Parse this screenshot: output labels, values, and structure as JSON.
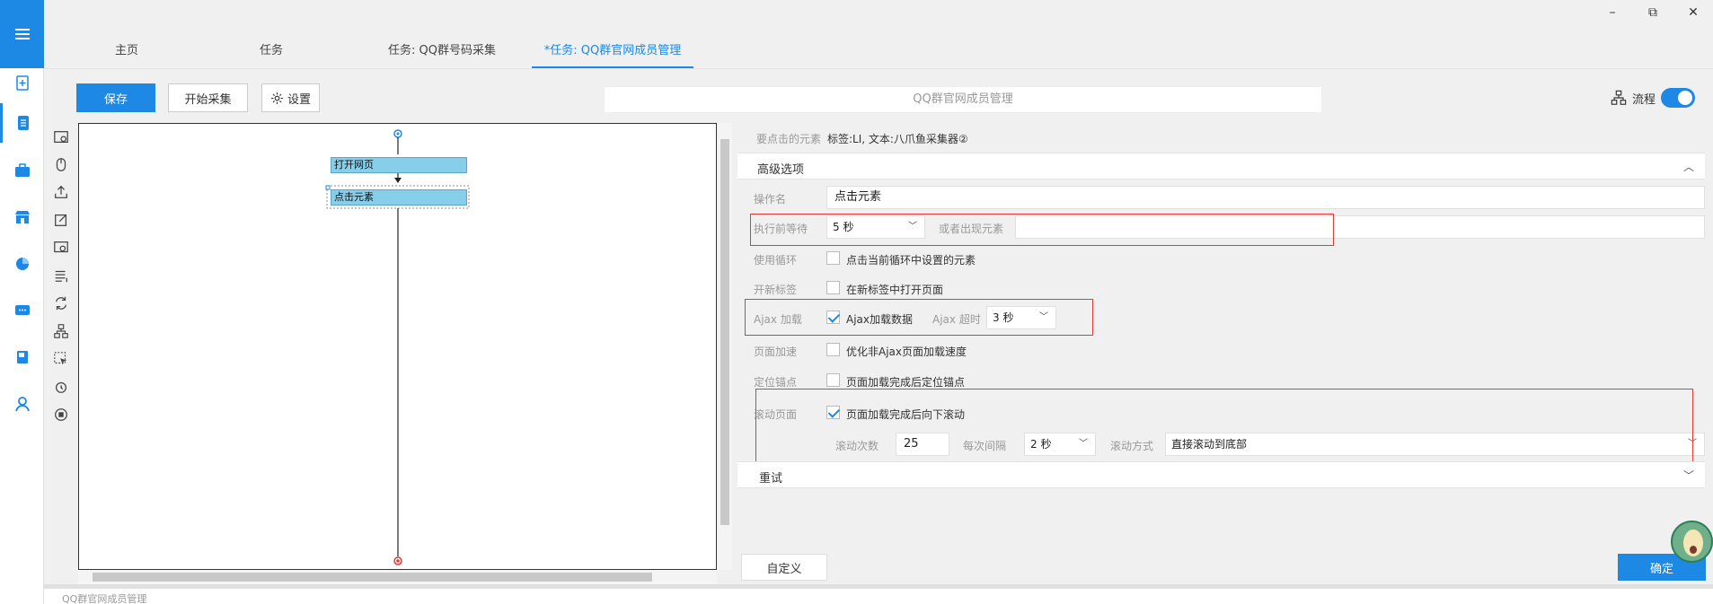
{
  "window": {
    "minimize": "–",
    "restore": "⧉",
    "close": "✕"
  },
  "tabs": [
    {
      "label": "主页"
    },
    {
      "label": "任务"
    },
    {
      "label": "任务: QQ群号码采集"
    },
    {
      "label": "*任务: QQ群官网成员管理"
    }
  ],
  "toolbar": {
    "save": "保存",
    "start": "开始采集",
    "settings": "设置",
    "task_name": "QQ群官网成员管理",
    "flow": "流程"
  },
  "canvas": {
    "nodes": [
      "打开网页",
      "点击元素"
    ]
  },
  "panel": {
    "click_target_label": "要点击的元素",
    "click_target_value": "标签:LI, 文本:八爪鱼采集器②",
    "advanced": "高级选项",
    "op_name_label": "操作名",
    "op_name_value": "点击元素",
    "wait_label": "执行前等待",
    "wait_value": "5 秒",
    "or_appear_label": "或者出现元素",
    "loop_label": "使用循环",
    "loop_text": "点击当前循环中设置的元素",
    "newtab_label": "开新标签",
    "newtab_text": "在新标签中打开页面",
    "ajax_label": "Ajax 加载",
    "ajax_text": "Ajax加载数据",
    "ajax_timeout_label": "Ajax 超时",
    "ajax_timeout_value": "3 秒",
    "speed_label": "页面加速",
    "speed_text": "优化非Ajax页面加载速度",
    "anchor_label": "定位锚点",
    "anchor_text": "页面加载完成后定位锚点",
    "scroll_label": "滚动页面",
    "scroll_text": "页面加载完成后向下滚动",
    "scroll_count_label": "滚动次数",
    "scroll_count_value": "25",
    "interval_label": "每次间隔",
    "interval_value": "2 秒",
    "scroll_mode_label": "滚动方式",
    "scroll_mode_value": "直接滚动到底部",
    "retry": "重试",
    "custom": "自定义",
    "ok": "确定"
  },
  "statusbar": {
    "text": "QQ群官网成员管理"
  }
}
